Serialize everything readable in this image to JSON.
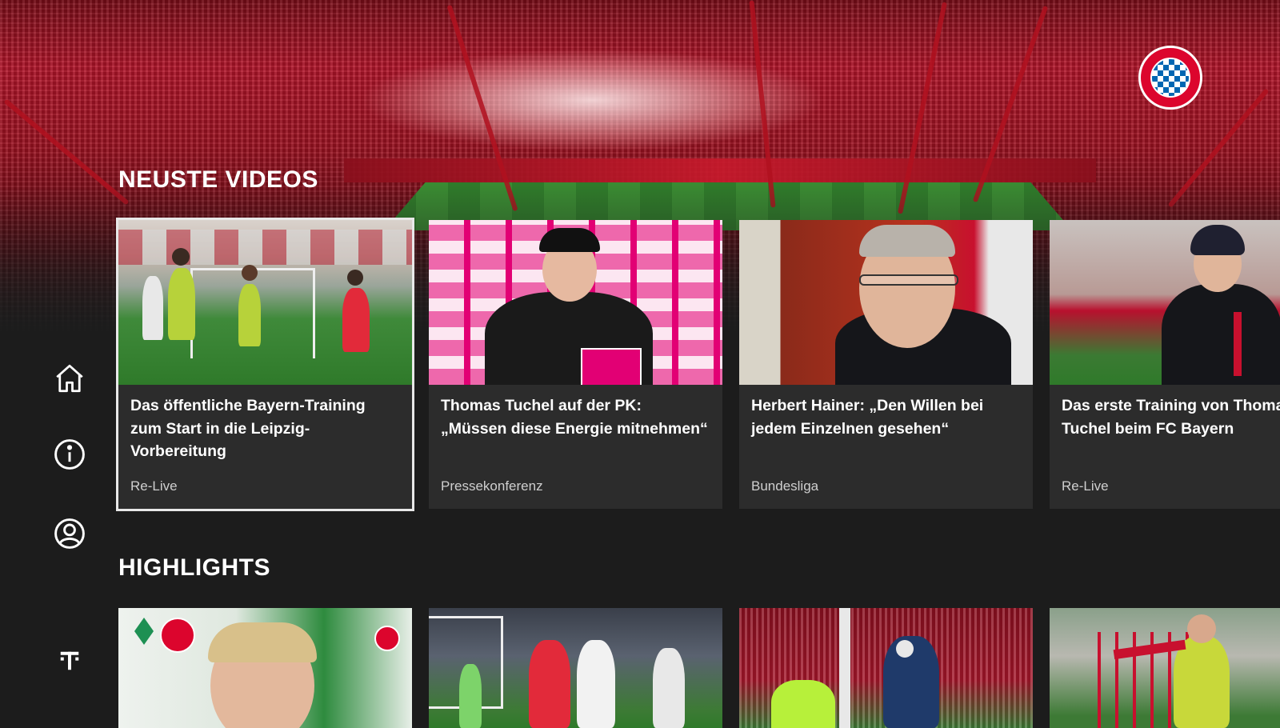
{
  "sections": {
    "latest_title": "NEUSTE VIDEOS",
    "highlights_title": "HIGHLIGHTS"
  },
  "sidebar": {
    "items": [
      {
        "icon": "home-icon"
      },
      {
        "icon": "info-icon"
      },
      {
        "icon": "profile-icon"
      },
      {
        "icon": "telekom-t-icon"
      }
    ]
  },
  "latest_videos": [
    {
      "title": "Das öffentliche Bayern-Training zum Start in die Leipzig-Vorbereitung",
      "category": "Re-Live"
    },
    {
      "title": "Thomas Tuchel auf der PK: „Müssen diese Energie mitnehmen“",
      "category": "Pressekonferenz"
    },
    {
      "title": "Herbert Hainer: „Den Willen bei jedem Einzelnen gesehen“",
      "category": "Bundesliga"
    },
    {
      "title": "Das erste Training von Thomas Tuchel beim FC Bayern",
      "category": "Re-Live"
    }
  ],
  "colors": {
    "background": "#1c1c1c",
    "card": "#2c2c2c",
    "accent_red": "#dc052d",
    "focus": "#e8e8e8"
  }
}
